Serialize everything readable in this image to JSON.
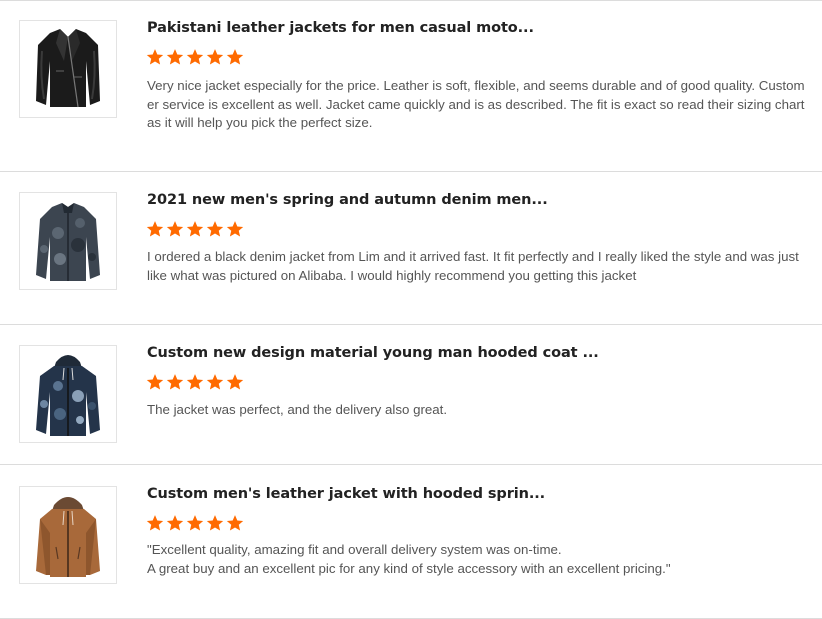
{
  "reviews": [
    {
      "product_title": "Pakistani leather jackets for men casual moto...",
      "rating": 5,
      "text": "Very nice jacket especially for the price. Leather is soft, flexible, and seems durable and of good quality. Customer service is excellent as well. Jacket came quickly and is as described. The fit is exact so read their sizing chart as it will help you pick the perfect size.",
      "image_icon": "black-leather-moto-jacket-image"
    },
    {
      "product_title": "2021 new men's spring and autumn denim men...",
      "rating": 5,
      "text": "I ordered a black denim jacket from Lim and it arrived fast. It fit perfectly and I really liked the style and was just like what was pictured on Alibaba. I would highly recommend you getting this jacket",
      "image_icon": "camo-denim-jacket-image"
    },
    {
      "product_title": "Custom new design material young man hooded coat ...",
      "rating": 5,
      "text": "The jacket was perfect, and the delivery also great.",
      "image_icon": "camo-hooded-coat-image"
    },
    {
      "product_title": "Custom men's leather jacket with hooded sprin...",
      "rating": 5,
      "text_lines": [
        "\"Excellent quality, amazing fit and overall delivery system was on-time.",
        "A great buy and an excellent pic for any kind of style accessory with an excellent pricing.\""
      ],
      "image_icon": "brown-leather-hooded-jacket-image"
    }
  ],
  "colors": {
    "star": "#ff6a00",
    "divider": "#dcdcdc",
    "title": "#222222",
    "body_text": "#555555"
  }
}
